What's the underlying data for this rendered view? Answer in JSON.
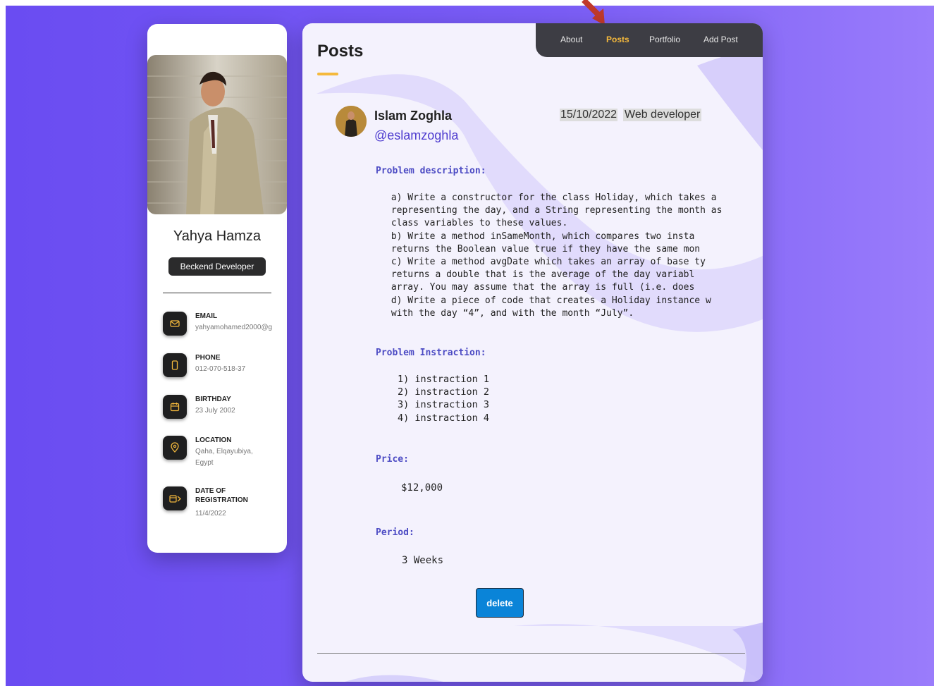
{
  "nav": {
    "items": [
      {
        "label": "About",
        "active": false
      },
      {
        "label": "Posts",
        "active": true
      },
      {
        "label": "Portfolio",
        "active": false
      },
      {
        "label": "Add Post",
        "active": false
      }
    ]
  },
  "sidebar": {
    "name": "Yahya Hamza",
    "role": "Beckend Developer",
    "contacts": [
      {
        "title": "EMAIL",
        "value": "yahyamohamed2000@g",
        "icon": "mail-icon"
      },
      {
        "title": "PHONE",
        "value": "012-070-518-37",
        "icon": "phone-icon"
      },
      {
        "title": "BIRTHDAY",
        "value": "23 July 2002",
        "icon": "calendar-icon"
      },
      {
        "title": "LOCATION",
        "value": "Qaha, Elqayubiya,",
        "value2": "Egypt",
        "icon": "location-pin-icon"
      },
      {
        "title": "DATE OF",
        "title2": "REGISTRATION",
        "value": "11/4/2022",
        "icon": "calendar-arrow-icon"
      }
    ]
  },
  "page": {
    "title": "Posts"
  },
  "post": {
    "author": "Islam Zoghla",
    "handle": "@eslamzoghla",
    "date": "15/10/2022",
    "job": "Web developer",
    "description_label": "Problem description:",
    "description": " a) Write a constructor for the class Holiday, which takes a\n representing the day, and a String representing the month as\n class variables to these values.\n b) Write a method inSameMonth, which compares two insta\n returns the Boolean value true if they have the same mon\n c) Write a method avgDate which takes an array of base ty\n returns a double that is the average of the day variabl\n array. You may assume that the array is full (i.e. does\n d) Write a piece of code that creates a Holiday instance w\n with the day “4”, and with the month “July”.",
    "instruction_label": "Problem Instraction:",
    "instructions": "1) instraction 1\n2) instraction 2\n3) instraction 3\n4) instraction 4",
    "price_label": "Price:",
    "price": "$12,000",
    "period_label": "Period:",
    "period": "3 Weeks",
    "delete_label": "delete"
  },
  "colors": {
    "background": "#6a4cf2",
    "accent": "#f5b93c",
    "link": "#4e3ccf",
    "delete": "#0a84d8"
  }
}
